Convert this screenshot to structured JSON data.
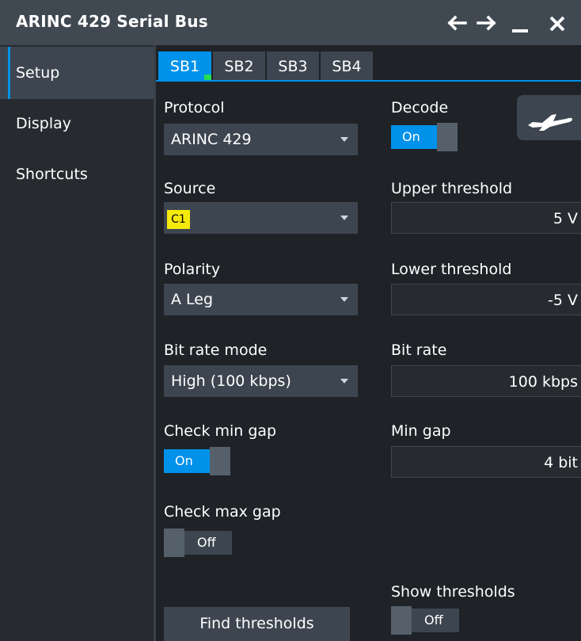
{
  "window": {
    "title": "ARINC 429 Serial Bus",
    "back_icon": "arrow-left-icon",
    "forward_icon": "arrow-right-icon",
    "minimize_icon": "minimize-icon",
    "close_icon": "close-icon"
  },
  "sidebar": {
    "items": [
      {
        "label": "Setup",
        "active": true
      },
      {
        "label": "Display",
        "active": false
      },
      {
        "label": "Shortcuts",
        "active": false
      }
    ]
  },
  "tabs": [
    {
      "label": "SB1",
      "active": true,
      "indicator": "green"
    },
    {
      "label": "SB2",
      "active": false
    },
    {
      "label": "SB3",
      "active": false
    },
    {
      "label": "SB4",
      "active": false
    }
  ],
  "form": {
    "protocol": {
      "label": "Protocol",
      "value": "ARINC 429"
    },
    "decode": {
      "label": "Decode",
      "state": "On"
    },
    "source": {
      "label": "Source",
      "value": "C1",
      "chip_color": "#f5e90c"
    },
    "upper_threshold": {
      "label": "Upper threshold",
      "value": "5 V"
    },
    "polarity": {
      "label": "Polarity",
      "value": "A Leg"
    },
    "lower_threshold": {
      "label": "Lower threshold",
      "value": "-5 V"
    },
    "bit_rate_mode": {
      "label": "Bit rate mode",
      "value": "High (100 kbps)"
    },
    "bit_rate": {
      "label": "Bit rate",
      "value": "100 kbps"
    },
    "check_min_gap": {
      "label": "Check min gap",
      "state": "On"
    },
    "min_gap": {
      "label": "Min gap",
      "value": "4 bit"
    },
    "check_max_gap": {
      "label": "Check max gap",
      "state": "Off"
    },
    "show_thresholds": {
      "label": "Show thresholds",
      "state": "Off"
    },
    "find_thresholds": {
      "label": "Find thresholds"
    },
    "aircraft_icon": "airplane-icon"
  },
  "colors": {
    "accent": "#0091ea",
    "background": "#1f2226",
    "panel": "#3d4650",
    "titlebar": "#404952",
    "c1_channel": "#f5e90c"
  }
}
